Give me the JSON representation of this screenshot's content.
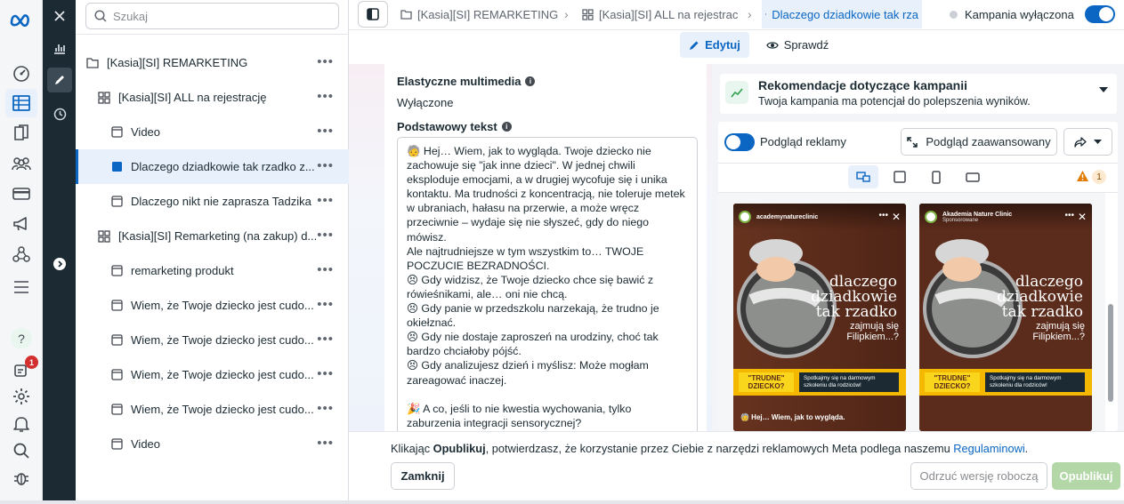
{
  "nav": {
    "items": [
      {
        "icon": "meta-logo-icon"
      },
      {
        "icon": "dashboard-icon"
      },
      {
        "icon": "table-icon",
        "active": true
      },
      {
        "icon": "pages-icon"
      },
      {
        "icon": "audiences-icon"
      },
      {
        "icon": "billing-icon"
      },
      {
        "icon": "megaphone-icon"
      },
      {
        "icon": "network-icon"
      },
      {
        "icon": "menu-icon"
      },
      {
        "icon": "help-icon"
      },
      {
        "icon": "notifications-icon"
      },
      {
        "icon": "settings-icon"
      },
      {
        "icon": "bell-icon"
      },
      {
        "icon": "search-icon"
      },
      {
        "icon": "bug-icon"
      }
    ],
    "notification_badge": "1"
  },
  "toolstrip": {
    "items": [
      "close-icon",
      "chart-icon",
      "pencil-icon",
      "clock-icon",
      "expand-icon"
    ],
    "active": "pencil-icon"
  },
  "tree": {
    "search_placeholder": "Szukaj",
    "items": [
      {
        "type": "campaign",
        "label": "[Kasia][SI] REMARKETING",
        "level": 0
      },
      {
        "type": "adset",
        "label": "[Kasia][SI] ALL na rejestrację",
        "level": 1
      },
      {
        "type": "ad",
        "label": "Video",
        "level": 2
      },
      {
        "type": "ad",
        "label": "Dlaczego dziadkowie tak rzadko z...",
        "level": 2,
        "selected": true
      },
      {
        "type": "ad",
        "label": "Dlaczego nikt nie zaprasza Tadzika",
        "level": 2
      },
      {
        "type": "adset",
        "label": "[Kasia][SI] Remarketing (na zakup) d...",
        "level": 1
      },
      {
        "type": "ad",
        "label": "remarketing produkt",
        "level": 2
      },
      {
        "type": "ad",
        "label": "Wiem, że Twoje dziecko jest cudo...",
        "level": 2
      },
      {
        "type": "ad",
        "label": "Wiem, że Twoje dziecko jest cudo...",
        "level": 2
      },
      {
        "type": "ad",
        "label": "Wiem, że Twoje dziecko jest cudo...",
        "level": 2
      },
      {
        "type": "ad",
        "label": "Wiem, że Twoje dziecko jest cudo...",
        "level": 2
      },
      {
        "type": "ad",
        "label": "Video",
        "level": 2
      }
    ],
    "more_label": "•••"
  },
  "topbar": {
    "breadcrumbs": [
      {
        "icon": "folder-icon",
        "label": "[Kasia][SI] REMARKETING"
      },
      {
        "icon": "grid-icon",
        "label": "[Kasia][SI] ALL na rejestrac"
      },
      {
        "icon": "ad-icon",
        "label": "Dlaczego dziadkowie tak rza",
        "current": true
      }
    ],
    "status_label": "Kampania wyłączona",
    "status_toggle_on": true,
    "tabs": {
      "edit": "Edytuj",
      "review": "Sprawdź"
    }
  },
  "editor": {
    "dynamic_media_title": "Elastyczne multimedia",
    "dynamic_media_value": "Wyłączone",
    "primary_text_title": "Podstawowy tekst",
    "primary_text_lines": [
      "🧓 Hej… Wiem, jak to wygląda. Twoje dziecko nie zachowuje się \"jak inne dzieci\". W jednej chwili eksploduje emocjami, a w drugiej wycofuje się i unika kontaktu. Ma trudności z koncentracją, nie toleruje metek w ubraniach, hałasu na przerwie, a może wręcz przeciwnie – wydaje się nie słyszeć, gdy do niego mówisz.",
      "Ale najtrudniejsze w tym wszystkim to… TWOJE POCZUCIE BEZRADNOŚCI.",
      "😣 Gdy widzisz, że Twoje dziecko chce się bawić z rówieśnikami, ale… oni nie chcą.",
      "😣 Gdy panie w przedszkolu narzekają, że trudno je okiełznać.",
      "😣 Gdy nie dostaje zaproszeń na urodziny, choć tak bardzo chciałoby pójść.",
      "😣 Gdy analizujesz dzień i myślisz: Może mogłam zareagować inaczej.",
      "",
      "🎉 A co, jeśli to nie kwestia wychowania, tylko zaburzenia integracji sensorycznej?"
    ]
  },
  "recommendations": {
    "title": "Rekomendacje dotyczące kampanii",
    "subtitle": "Twoja kampania ma potencjał do polepszenia wyników."
  },
  "preview": {
    "toggle_label": "Podgląd reklamy",
    "toggle_on": true,
    "advanced_label": "Podgląd zaawansowany",
    "warnings_count": "1",
    "ads": [
      {
        "account": "academynatureclinic",
        "sponsored": "",
        "headline": "dlaczego dziadkowie tak rzadko",
        "subline": "zajmują się Filipkiem...?",
        "tag": "\"TRUDNE\" DZIECKO?",
        "note": "Spotkajmy się na darmowym szkoleniu dla rodziców!",
        "caption": "🧓 Hej… Wiem, jak to wygląda."
      },
      {
        "account": "Akademia Nature Clinic",
        "sponsored": "Sponsorowane",
        "headline": "dlaczego dziadkowie tak rzadko",
        "subline": "zajmują się Filipkiem...?",
        "tag": "\"TRUDNE\" DZIECKO?",
        "note": "Spotkajmy się na darmowym szkoleniu dla rodziców!",
        "caption": ""
      }
    ]
  },
  "footer": {
    "text_before": "Klikając ",
    "text_bold": "Opublikuj",
    "text_middle": ", potwierdzasz, że korzystanie przez Ciebie z narzędzi reklamowych Meta podlega naszemu ",
    "link_label": "Regulaminowi",
    "text_after": ".",
    "close_label": "Zamknij",
    "discard_label": "Odrzuć wersję roboczą",
    "publish_label": "Opublikuj"
  },
  "colors": {
    "accent": "#0a66c2",
    "publish_disabled": "#b3d7a7",
    "dark_strip": "#1c2b33"
  }
}
